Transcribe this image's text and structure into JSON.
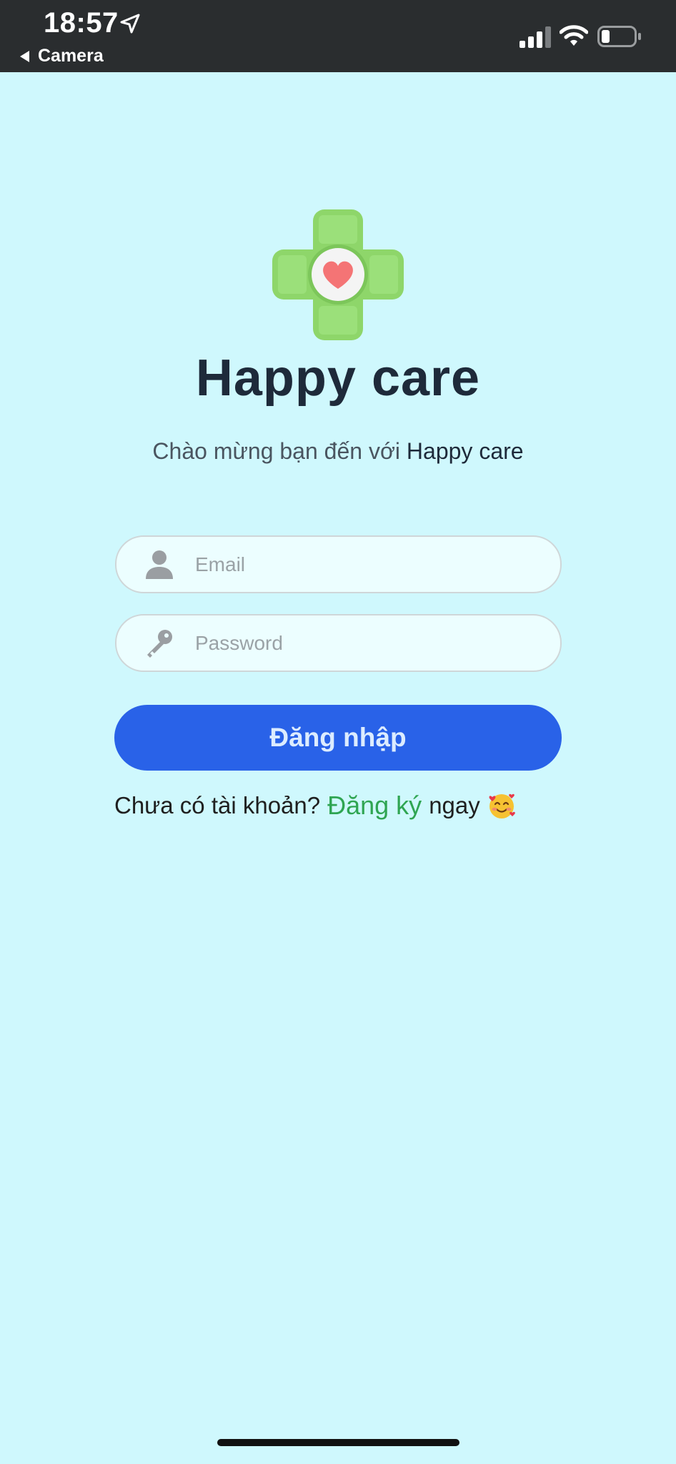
{
  "status_bar": {
    "time": "18:57",
    "back_label": "Camera",
    "icons": [
      "location-arrow-icon",
      "cellular-signal-icon",
      "wifi-icon",
      "battery-icon"
    ]
  },
  "app": {
    "title": "Happy care",
    "welcome_prefix": "Chào mừng bạn đến với ",
    "welcome_brand": "Happy care",
    "logo_icon": "medical-cross-heart-logo"
  },
  "form": {
    "email": {
      "placeholder": "Email",
      "value": "",
      "icon": "user-icon"
    },
    "password": {
      "placeholder": "Password",
      "value": "",
      "icon": "key-icon"
    },
    "login_label": "Đăng nhập"
  },
  "signup": {
    "prefix": "Chưa có tài khoản?",
    "link": "Đăng ký",
    "suffix": "ngay",
    "emoji_icon": "smiling-face-with-hearts-icon"
  },
  "colors": {
    "background": "#cff8fd",
    "status_bar": "#2a2d2f",
    "primary_button": "#2962e8",
    "signup_link": "#2fa552",
    "title": "#1e2a3a",
    "logo_cross": "#8ed66a",
    "logo_heart": "#f47475"
  }
}
